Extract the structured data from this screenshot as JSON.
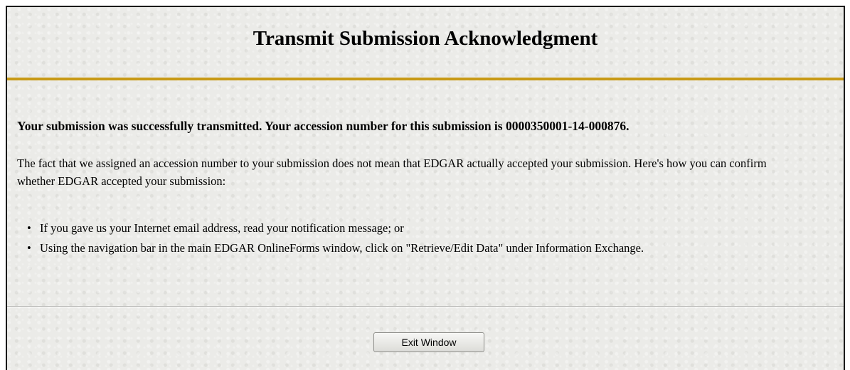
{
  "page": {
    "title": "Transmit Submission Acknowledgment"
  },
  "message": {
    "success": "Your submission was successfully transmitted. Your accession number for this submission is 0000350001-14-000876.",
    "info": "The fact that we assigned an accession number to your submission does not mean that EDGAR actually accepted your submission. Here's how you can confirm whether EDGAR accepted your submission:",
    "bullets": [
      "If you gave us your Internet email address, read your notification message; or",
      "Using the navigation bar in the main EDGAR OnlineForms window, click on \"Retrieve/Edit Data\" under Information Exchange."
    ]
  },
  "actions": {
    "exit_label": "Exit Window"
  },
  "colors": {
    "accent_rule": "#c89a16",
    "background": "#ebebe8"
  },
  "icons": {
    "bullet": "•"
  }
}
